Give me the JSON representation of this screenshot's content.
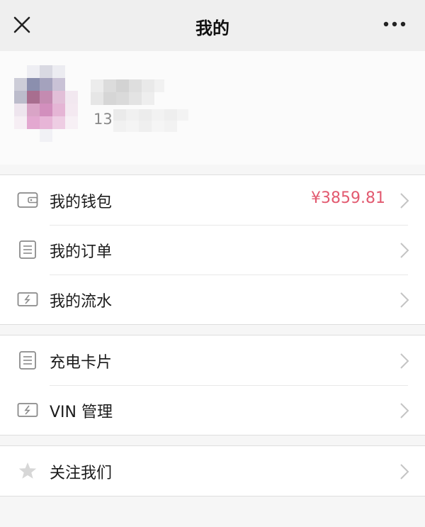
{
  "header": {
    "title": "我的",
    "close_icon": "close-icon",
    "more_icon": "more-icon"
  },
  "profile": {
    "phone_prefix": "13"
  },
  "groups": [
    {
      "items": [
        {
          "label": "我的钱包",
          "value": "¥3859.81",
          "icon": "wallet-icon"
        },
        {
          "label": "我的订单",
          "icon": "document-icon"
        },
        {
          "label": "我的流水",
          "icon": "money-icon"
        }
      ]
    },
    {
      "items": [
        {
          "label": "充电卡片",
          "icon": "document-icon"
        },
        {
          "label": "VIN 管理",
          "icon": "money-icon"
        }
      ]
    },
    {
      "items": [
        {
          "label": "关注我们",
          "icon": "star-icon"
        }
      ]
    }
  ],
  "colors": {
    "accent_value": "#e25a70"
  }
}
